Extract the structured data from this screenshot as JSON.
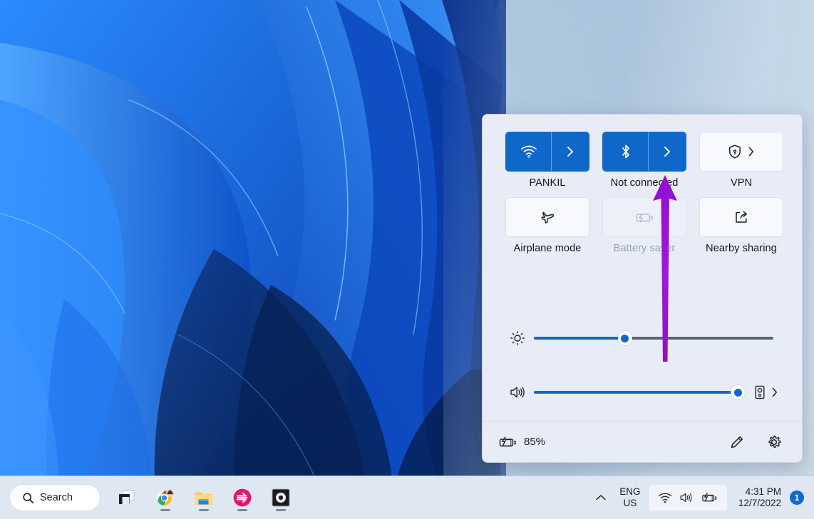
{
  "quick_settings": {
    "tiles": [
      {
        "label": "PANKIL",
        "icon": "wifi-icon",
        "state": "on",
        "has_chevron": true,
        "chevron_split": true
      },
      {
        "label": "Not connected",
        "icon": "bluetooth-icon",
        "state": "on",
        "has_chevron": true,
        "chevron_split": true
      },
      {
        "label": "VPN",
        "icon": "vpn-shield-icon",
        "state": "off",
        "has_chevron": true,
        "chevron_split": false
      },
      {
        "label": "Airplane mode",
        "icon": "airplane-icon",
        "state": "off",
        "has_chevron": false,
        "chevron_split": false
      },
      {
        "label": "Battery saver",
        "icon": "battery-saver-icon",
        "state": "disabled",
        "has_chevron": false,
        "chevron_split": false
      },
      {
        "label": "Nearby sharing",
        "icon": "nearby-sharing-icon",
        "state": "off",
        "has_chevron": false,
        "chevron_split": false
      }
    ],
    "sliders": [
      {
        "name": "brightness",
        "icon": "brightness-icon",
        "value": 38,
        "fill_color": "#0f68c9",
        "track_color": "#5c6270"
      },
      {
        "name": "volume",
        "icon": "volume-icon",
        "value": 98,
        "fill_color": "#0f68c9",
        "track_color": "#5c6270"
      }
    ],
    "audio_output": {
      "icon": "speaker-select-icon",
      "chevron": "chevron-right-icon"
    },
    "footer": {
      "battery_icon": "battery-charging-icon",
      "battery_percent": "85%",
      "edit_button": "edit-pencil-icon",
      "settings_button": "gear-icon"
    }
  },
  "annotation": {
    "type": "arrow",
    "color": "#9810D0",
    "direction": "up",
    "points_at": "Not connected"
  },
  "taskbar": {
    "search": {
      "icon": "search-icon",
      "label": "Search"
    },
    "apps": [
      {
        "name": "task-view",
        "running": false
      },
      {
        "name": "google-chrome",
        "running": true
      },
      {
        "name": "file-explorer",
        "running": true
      },
      {
        "name": "pink-app",
        "running": true
      },
      {
        "name": "dark-app",
        "running": true
      }
    ],
    "tray": {
      "overflow_icon": "chevron-up-icon",
      "language_line1": "ENG",
      "language_line2": "US",
      "quick_icons": [
        "wifi-icon",
        "volume-icon",
        "battery-charging-icon"
      ],
      "time": "4:31 PM",
      "date": "12/7/2022",
      "notification_count": "1"
    }
  },
  "colors": {
    "accent_blue": "#0f68c9",
    "panel_bg": "#e8ecf6",
    "tile_off": "#f7f9fd",
    "taskbar_bg": "#dfe7f3",
    "annotation_purple": "#9810D0"
  }
}
